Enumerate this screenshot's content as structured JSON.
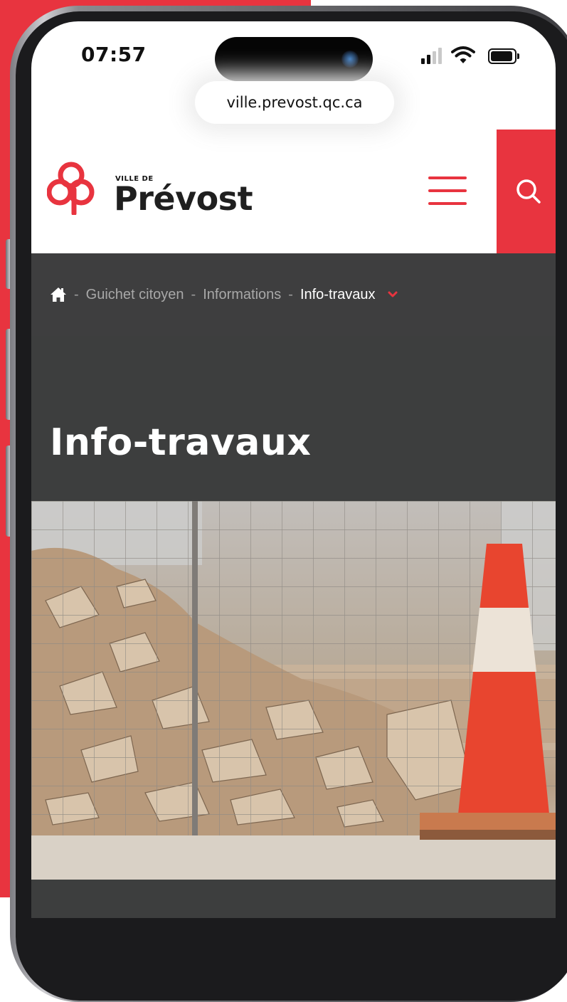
{
  "status_bar": {
    "time": "07:57",
    "icons": [
      "signal-icon",
      "wifi-icon",
      "battery-icon"
    ]
  },
  "browser": {
    "url": "ville.prevost.qc.ca"
  },
  "header": {
    "logo_small": "VILLE DE",
    "logo_name": "Prévost",
    "menu_icon": "hamburger-menu-icon",
    "search_icon": "search-icon"
  },
  "breadcrumb": {
    "home_icon": "home-icon",
    "separator": "-",
    "items": [
      "Guichet citoyen",
      "Informations"
    ],
    "current": "Info-travaux",
    "dropdown_icon": "chevron-down-icon"
  },
  "page": {
    "title": "Info-travaux"
  },
  "colors": {
    "brand_red": "#e8343f",
    "dark_band": "#3e3e3f",
    "crumb_text": "#a8a8a8"
  }
}
